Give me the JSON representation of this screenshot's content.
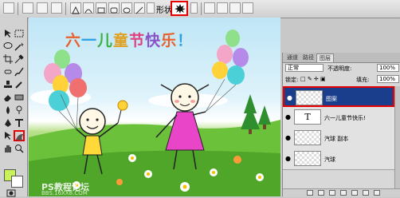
{
  "options_bar": {
    "shape_label": "形状:",
    "icons": [
      "path-mode-icon",
      "shape-layer-icon",
      "pen-icon",
      "freeform-pen-icon",
      "rectangle-icon",
      "rounded-rect-icon",
      "ellipse-icon",
      "polygon-icon",
      "line-icon",
      "custom-shape-icon",
      "dropdown-icon",
      "custom-shape-picker",
      "add-icon",
      "subtract-icon",
      "intersect-icon",
      "exclude-icon"
    ]
  },
  "canvas": {
    "title_chars": [
      "六",
      "一",
      "儿",
      "童",
      "节",
      "快",
      "乐",
      "！"
    ],
    "watermark": "PS教程论坛",
    "watermark_sub": "BBS.16XX8.COM"
  },
  "layers_panel": {
    "tabs": [
      "图层",
      "通道",
      "路径"
    ],
    "blend_mode": "正常",
    "opacity_label": "不透明度:",
    "opacity_value": "100%",
    "lock_label": "锁定:",
    "fill_label": "填充:",
    "fill_value": "100%",
    "layers": [
      {
        "name": "图案",
        "selected": true
      },
      {
        "name": "六一儿童节快乐!",
        "selected": false
      },
      {
        "name": "汽球 副本",
        "selected": false
      },
      {
        "name": "汽球",
        "selected": false
      }
    ],
    "text_thumb": "T"
  },
  "colors": {
    "foreground": "#c9f25a",
    "background": "#ffffff",
    "highlight": "#e60000",
    "selection": "#1a3d8c"
  }
}
